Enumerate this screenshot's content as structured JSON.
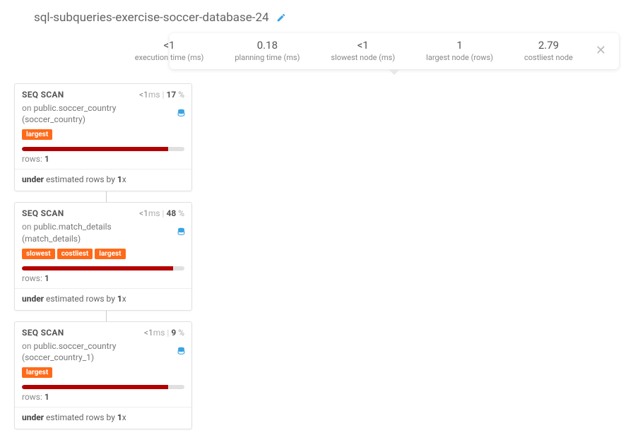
{
  "title": "sql-subqueries-exercise-soccer-database-24",
  "stats": [
    {
      "value": "<1",
      "label": "execution time (ms)"
    },
    {
      "value": "0.18",
      "label": "planning time (ms)"
    },
    {
      "value": "<1",
      "label": "slowest node (ms)"
    },
    {
      "value": "1",
      "label": "largest node (rows)"
    },
    {
      "value": "2.79",
      "label": "costliest node"
    }
  ],
  "nodes": [
    {
      "op": "SEQ SCAN",
      "time": "<1",
      "time_unit": "ms",
      "pct": "17",
      "on_prefix": "on ",
      "table": "public.soccer_country (soccer_country)",
      "tags": [
        "largest"
      ],
      "bar_pct": 90,
      "rows_label": "rows:",
      "rows": "1",
      "est_prefix": "under",
      "est_mid": " estimated rows by ",
      "est_factor": "1",
      "est_suffix": "x"
    },
    {
      "op": "SEQ SCAN",
      "time": "<1",
      "time_unit": "ms",
      "pct": "48",
      "on_prefix": "on ",
      "table": "public.match_details (match_details)",
      "tags": [
        "slowest",
        "costliest",
        "largest"
      ],
      "bar_pct": 93,
      "rows_label": "rows:",
      "rows": "1",
      "est_prefix": "under",
      "est_mid": " estimated rows by ",
      "est_factor": "1",
      "est_suffix": "x"
    },
    {
      "op": "SEQ SCAN",
      "time": "<1",
      "time_unit": "ms",
      "pct": "9",
      "on_prefix": "on ",
      "table": "public.soccer_country (soccer_country_1)",
      "tags": [
        "largest"
      ],
      "bar_pct": 90,
      "rows_label": "rows:",
      "rows": "1",
      "est_prefix": "under",
      "est_mid": " estimated rows by ",
      "est_factor": "1",
      "est_suffix": "x"
    }
  ]
}
